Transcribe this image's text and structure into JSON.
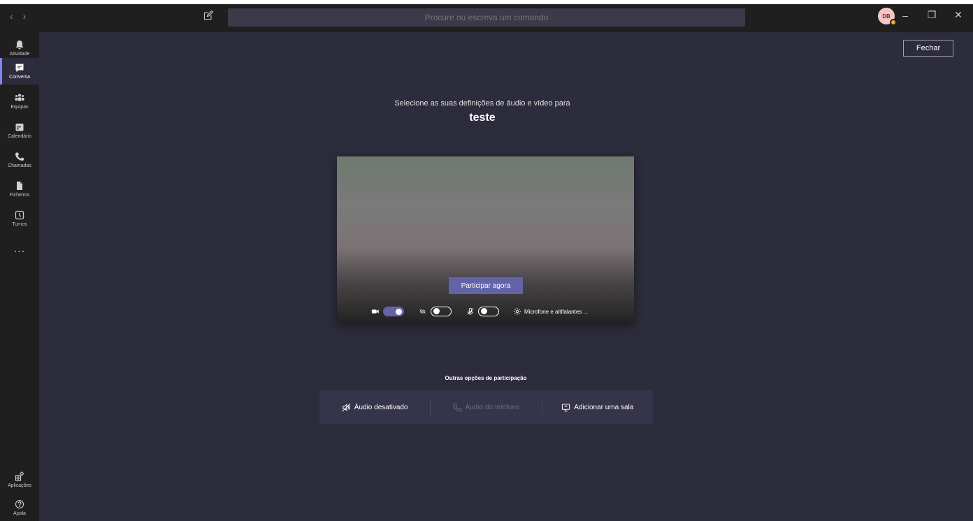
{
  "titlebar": {
    "search_placeholder": "Procure ou escreva um comando",
    "avatar_initials": "DB"
  },
  "rail": {
    "items": [
      {
        "label": "Atividade",
        "icon": "bell-icon"
      },
      {
        "label": "Conversa",
        "icon": "chat-icon",
        "active": true
      },
      {
        "label": "Equipas",
        "icon": "teams-icon"
      },
      {
        "label": "Calendário",
        "icon": "calendar-icon"
      },
      {
        "label": "Chamadas",
        "icon": "phone-icon"
      },
      {
        "label": "Ficheiros",
        "icon": "file-icon"
      },
      {
        "label": "Turnos",
        "icon": "clock-icon"
      }
    ],
    "more": "...",
    "apps_label": "Aplicações",
    "help_label": "Ajuda"
  },
  "main": {
    "close_label": "Fechar",
    "subtitle": "Selecione as suas definições de áudio e vídeo para",
    "meeting_title": "teste",
    "join_label": "Participar agora",
    "camera_on": true,
    "blur_on": false,
    "mic_on": false,
    "device_settings_label": "Microfone e altifalantes ...",
    "other_options_label": "Outras opções de participação",
    "options": [
      {
        "label": "Áudio desativado",
        "icon": "speaker-off-icon",
        "enabled": true
      },
      {
        "label": "Áudio do telefone",
        "icon": "phone-icon",
        "enabled": false
      },
      {
        "label": "Adicionar uma sala",
        "icon": "room-icon",
        "enabled": true
      }
    ]
  },
  "colors": {
    "accent": "#6264a7",
    "background": "#2d2c3c",
    "rail": "#1f1f1f"
  }
}
